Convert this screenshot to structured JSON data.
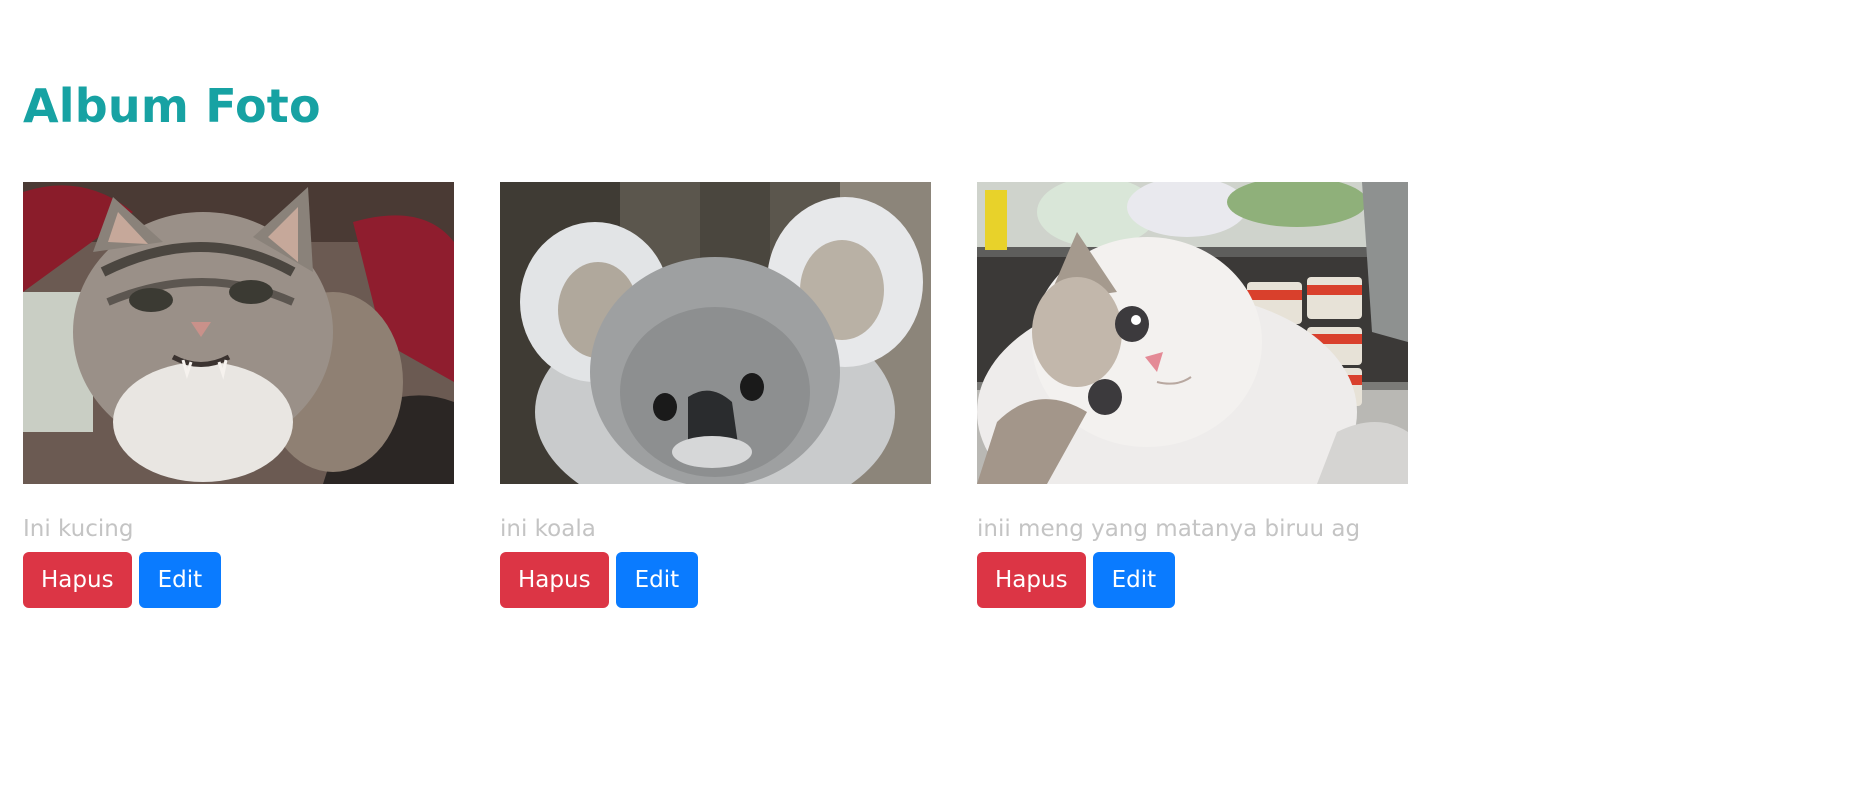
{
  "page": {
    "title": "Album Foto"
  },
  "colors": {
    "title": "#17a2a3",
    "danger": "#dc3545",
    "primary": "#0a7bff",
    "caption": "#c4c4c4"
  },
  "photos": [
    {
      "caption": "Ini kucing",
      "image_subject": "grumpy tabby cat",
      "delete_label": "Hapus",
      "edit_label": "Edit"
    },
    {
      "caption": "ini koala",
      "image_subject": "koala",
      "delete_label": "Hapus",
      "edit_label": "Edit"
    },
    {
      "caption": "inii meng yang matanya biruu ag",
      "image_subject": "white fluffy cat in front of shelves",
      "delete_label": "Hapus",
      "edit_label": "Edit"
    }
  ]
}
